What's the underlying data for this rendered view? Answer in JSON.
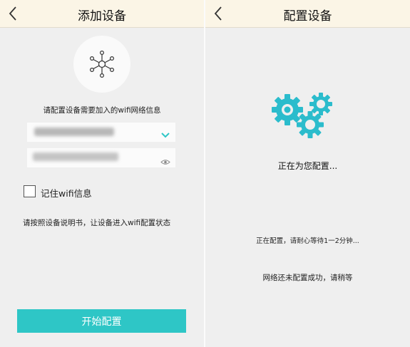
{
  "left": {
    "title": "添加设备",
    "hint": "请配置设备需要加入的wifi网络信息",
    "remember_label": "记住wifi信息",
    "instruction": "请按照设备说明书，让设备进入wifi配置状态",
    "start_button": "开始配置"
  },
  "right": {
    "title": "配置设备",
    "status_main": "正在为您配置...",
    "status_wait": "正在配置，请耐心等待1一2分钟...",
    "status_result": "网络还未配置成功，请稍等"
  },
  "colors": {
    "accent": "#2ec6c6",
    "header_bg": "#fbf5e6",
    "gear": "#2bbccc"
  },
  "icons": [
    "back-arrow-icon",
    "network-device-icon",
    "chevron-down-icon",
    "eye-icon",
    "gears-icon"
  ]
}
